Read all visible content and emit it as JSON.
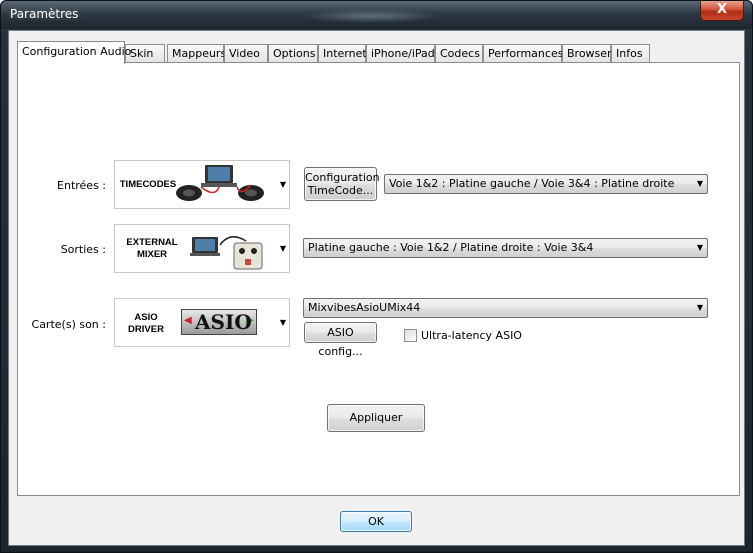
{
  "window": {
    "title": "Paramètres",
    "close_glyph": "X"
  },
  "tabs": [
    {
      "label": "Configuration Audio",
      "active": true
    },
    {
      "label": "Skin"
    },
    {
      "label": "Mappeurs"
    },
    {
      "label": "Video"
    },
    {
      "label": "Options"
    },
    {
      "label": "Internet"
    },
    {
      "label": "iPhone/iPad"
    },
    {
      "label": "Codecs"
    },
    {
      "label": "Performances"
    },
    {
      "label": "Browser"
    },
    {
      "label": "Infos"
    }
  ],
  "inputs": {
    "label": "Entrées :",
    "image_caption": "TIMECODES",
    "config_button_line1": "Configuration",
    "config_button_line2": "TimeCode...",
    "routing_value": "Voie 1&2 : Platine gauche / Voie 3&4 : Platine droite"
  },
  "outputs": {
    "label": "Sorties :",
    "image_caption_line1": "EXTERNAL",
    "image_caption_line2": "MIXER",
    "routing_value": "Platine gauche : Voie 1&2 / Platine droite : Voie 3&4"
  },
  "soundcard": {
    "label": "Carte(s) son :",
    "image_caption_line1": "ASIO",
    "image_caption_line2": "DRIVER",
    "logo_text": "ASIO",
    "device_value": "MixvibesAsioUMix44",
    "asio_config_label": "ASIO config...",
    "ultra_latency_label": "Ultra-latency ASIO",
    "ultra_latency_checked": false
  },
  "apply_label": "Appliquer",
  "ok_label": "OK",
  "dropdown_glyph": "▼"
}
